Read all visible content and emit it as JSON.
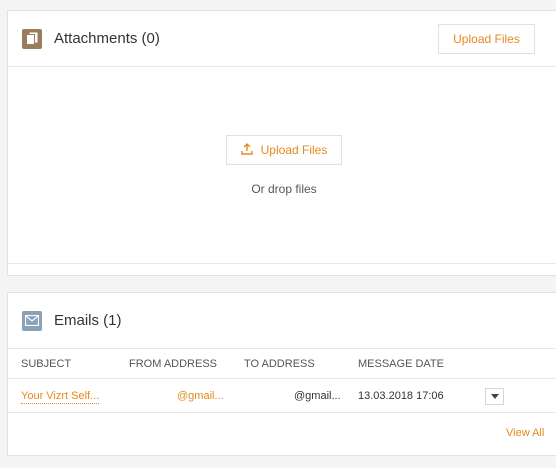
{
  "attachments": {
    "title": "Attachments (0)",
    "upload_button": "Upload Files",
    "drop_upload_button": "Upload Files",
    "drop_hint": "Or drop files",
    "icon": "file-stack-icon"
  },
  "emails": {
    "title": "Emails (1)",
    "icon": "envelope-icon",
    "columns": [
      "SUBJECT",
      "FROM ADDRESS",
      "TO ADDRESS",
      "MESSAGE DATE"
    ],
    "rows": [
      {
        "subject": "Your Vizrt Self...",
        "from": "@gmail...",
        "to": "@gmail...",
        "date": "13.03.2018 17:06"
      }
    ],
    "view_all": "View All"
  },
  "colors": {
    "accent": "#e38a1e",
    "attachment_icon_bg": "#9a7d5d",
    "email_icon_bg": "#8aa2b8"
  }
}
